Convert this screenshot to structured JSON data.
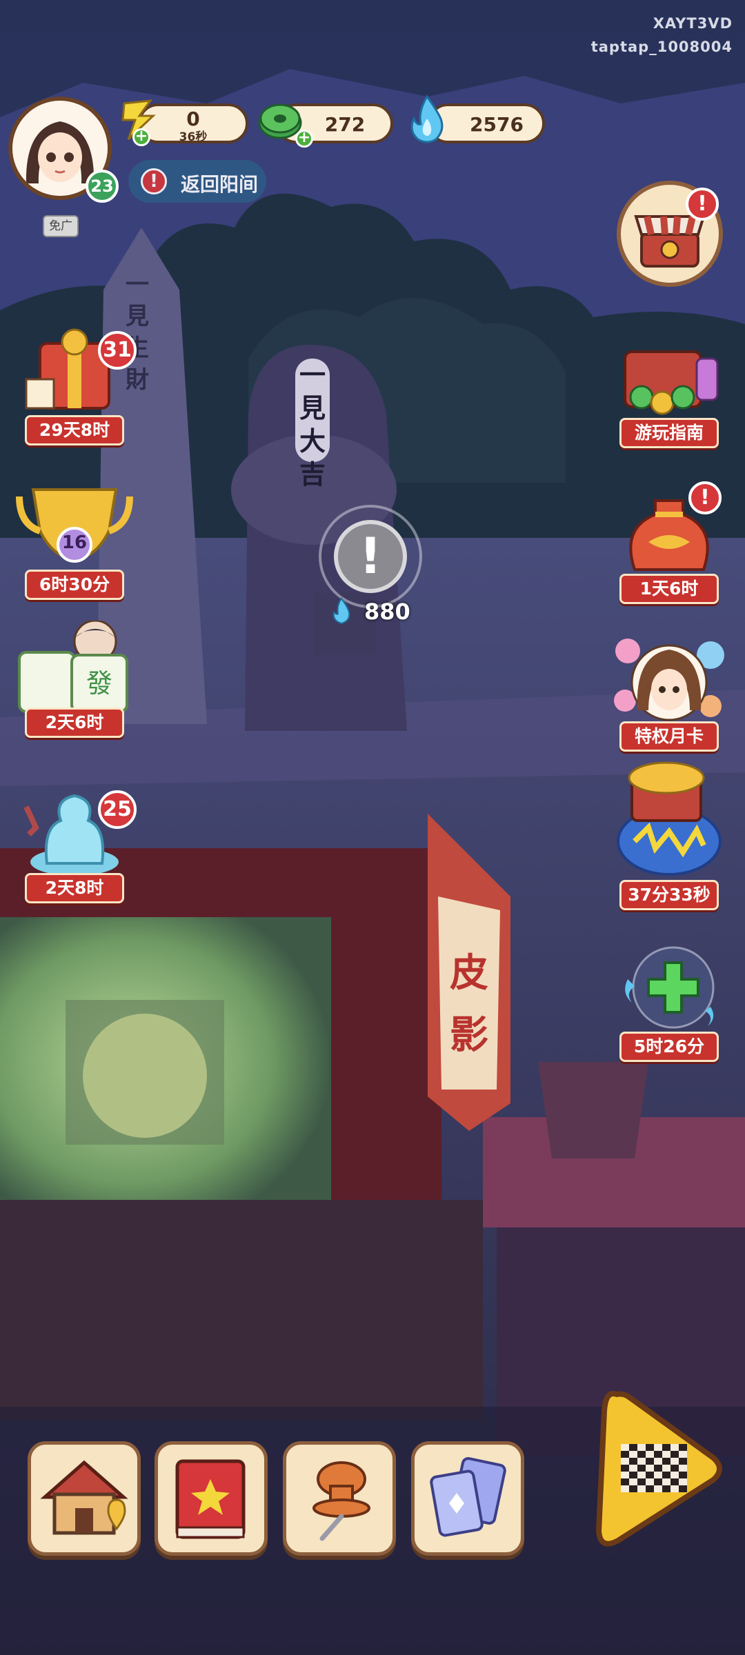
{
  "watermark": {
    "line1": "XAYT3VD",
    "line2": "taptap_1008004"
  },
  "player": {
    "level": "23",
    "no_ads_label": "免广"
  },
  "resources": {
    "energy": {
      "value": "0",
      "timer": "36秒",
      "icon": "lightning-icon"
    },
    "coins": {
      "value": "272",
      "icon": "jade-coin-icon"
    },
    "flames": {
      "value": "2576",
      "icon": "blue-flame-icon"
    }
  },
  "return_button": {
    "label": "返回阳间",
    "icon": "alert-icon"
  },
  "left_events": [
    {
      "label": "29天8时",
      "badge": "31",
      "icon": "gift-box-icon"
    },
    {
      "label": "6时30分",
      "badge": "16",
      "icon": "golden-trophy-icon"
    },
    {
      "label": "2天6时",
      "badge": "",
      "icon": "mahjong-tile-icon"
    },
    {
      "label": "2天8时",
      "badge": "25",
      "icon": "jade-statue-icon"
    }
  ],
  "right_events": [
    {
      "label": "游玩指南",
      "icon": "treasure-chest-icon"
    },
    {
      "label": "1天6时",
      "icon": "lucky-bag-icon",
      "alert": "!"
    },
    {
      "label": "特权月卡",
      "icon": "character-card-icon"
    },
    {
      "label": "37分33秒",
      "icon": "gold-treasure-icon"
    },
    {
      "label": "5时26分",
      "icon": "heal-orb-icon"
    }
  ],
  "shop": {
    "icon": "shop-stall-icon",
    "alert": "!"
  },
  "npc": {
    "cost": "880",
    "icon": "exclamation-icon",
    "cost_icon": "blue-flame-icon"
  },
  "tombstone_text": {
    "front": "一見大吉",
    "back": "一見生財"
  },
  "banner_text": "皮影",
  "bottom_nav": [
    {
      "name": "home",
      "icon": "house-icon"
    },
    {
      "name": "book",
      "icon": "book-icon"
    },
    {
      "name": "pin",
      "icon": "pushpin-icon"
    },
    {
      "name": "cards",
      "icon": "cards-icon"
    }
  ],
  "board_button": {
    "icon": "checkerboard-icon"
  }
}
